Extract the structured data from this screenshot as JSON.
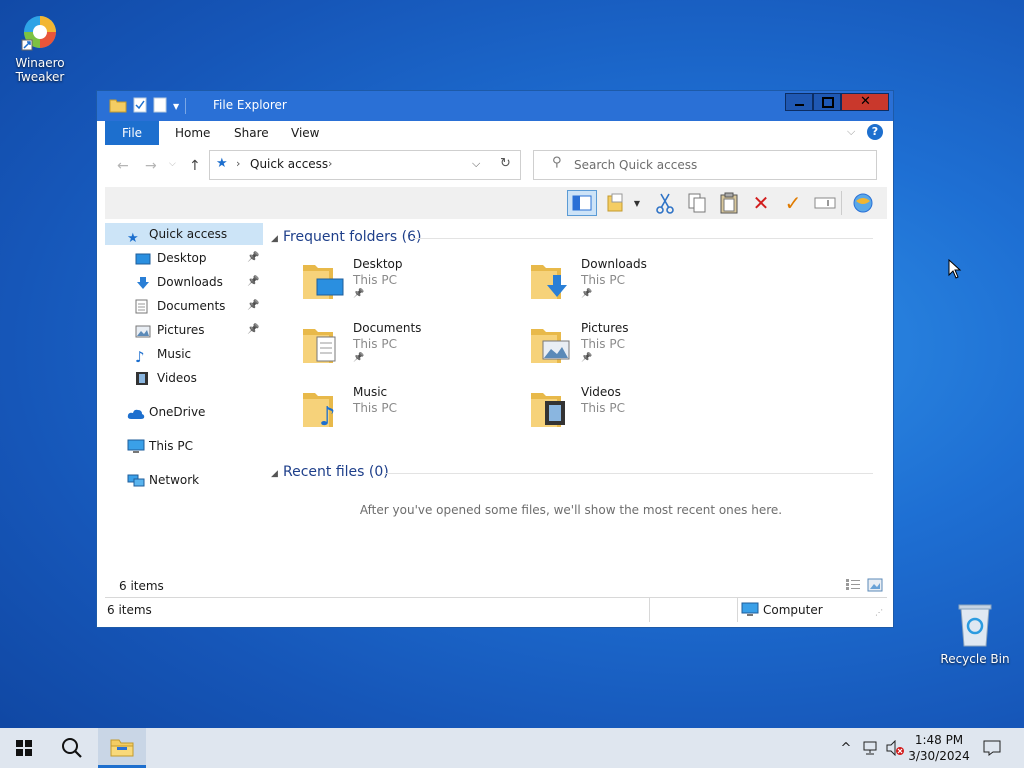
{
  "desktop": {
    "icons": [
      {
        "label_line1": "Winaero",
        "label_line2": "Tweaker"
      },
      {
        "label_line1": "Recycle Bin",
        "label_line2": ""
      }
    ]
  },
  "window": {
    "title": "File Explorer",
    "ribbon_tabs": [
      "File",
      "Home",
      "Share",
      "View"
    ],
    "address": {
      "location": "Quick access"
    },
    "search": {
      "placeholder": "Search Quick access"
    },
    "nav": {
      "items": [
        {
          "label": "Quick access",
          "selected": true,
          "indent": false,
          "pinned": false,
          "icon": "star-icon"
        },
        {
          "label": "Desktop",
          "selected": false,
          "indent": true,
          "pinned": true,
          "icon": "desktop-icon"
        },
        {
          "label": "Downloads",
          "selected": false,
          "indent": true,
          "pinned": true,
          "icon": "download-icon"
        },
        {
          "label": "Documents",
          "selected": false,
          "indent": true,
          "pinned": true,
          "icon": "document-icon"
        },
        {
          "label": "Pictures",
          "selected": false,
          "indent": true,
          "pinned": true,
          "icon": "picture-icon"
        },
        {
          "label": "Music",
          "selected": false,
          "indent": true,
          "pinned": false,
          "icon": "music-note-icon"
        },
        {
          "label": "Videos",
          "selected": false,
          "indent": true,
          "pinned": false,
          "icon": "film-icon"
        },
        {
          "label": "OneDrive",
          "selected": false,
          "indent": false,
          "pinned": false,
          "icon": "cloud-icon"
        },
        {
          "label": "This PC",
          "selected": false,
          "indent": false,
          "pinned": false,
          "icon": "computer-icon"
        },
        {
          "label": "Network",
          "selected": false,
          "indent": false,
          "pinned": false,
          "icon": "network-icon"
        }
      ]
    },
    "frequent": {
      "header": "Frequent folders (6)",
      "folders": [
        {
          "name": "Desktop",
          "location": "This PC",
          "pinned": true,
          "icon": "desktop-folder-icon"
        },
        {
          "name": "Downloads",
          "location": "This PC",
          "pinned": true,
          "icon": "downloads-folder-icon"
        },
        {
          "name": "Documents",
          "location": "This PC",
          "pinned": true,
          "icon": "documents-folder-icon"
        },
        {
          "name": "Pictures",
          "location": "This PC",
          "pinned": true,
          "icon": "pictures-folder-icon"
        },
        {
          "name": "Music",
          "location": "This PC",
          "pinned": false,
          "icon": "music-folder-icon"
        },
        {
          "name": "Videos",
          "location": "This PC",
          "pinned": false,
          "icon": "videos-folder-icon"
        }
      ]
    },
    "recent": {
      "header": "Recent files (0)",
      "empty_message": "After you've opened some files, we'll show the most recent ones here."
    },
    "status": {
      "items_count": "6 items",
      "items_count_bottom": "6 items",
      "location_label": "Computer"
    }
  },
  "taskbar": {
    "time": "1:48 PM",
    "date": "3/30/2024"
  },
  "colors": {
    "accent": "#1d6fce",
    "titlebar": "#2a70d6",
    "close": "#c9382c",
    "group_header": "#1e3f8a"
  }
}
